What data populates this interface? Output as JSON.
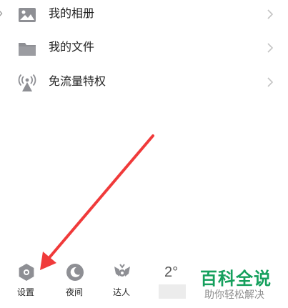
{
  "menu": {
    "items": [
      {
        "label": "我的相册",
        "icon": "photo-icon"
      },
      {
        "label": "我的文件",
        "icon": "folder-icon"
      },
      {
        "label": "免流量特权",
        "icon": "signal-tower-icon"
      }
    ]
  },
  "bottom_bar": {
    "settings_label": "设置",
    "night_label": "夜间",
    "expert_label": "达人",
    "weather_temp": "2°"
  },
  "watermark": {
    "title": "百科全说",
    "subtitle": "助你轻松解决"
  },
  "colors": {
    "icon": "#8e8f94",
    "chevron": "#c4c4c4",
    "annotation_arrow": "#f03a3a",
    "watermark_green": "#16a05d"
  }
}
